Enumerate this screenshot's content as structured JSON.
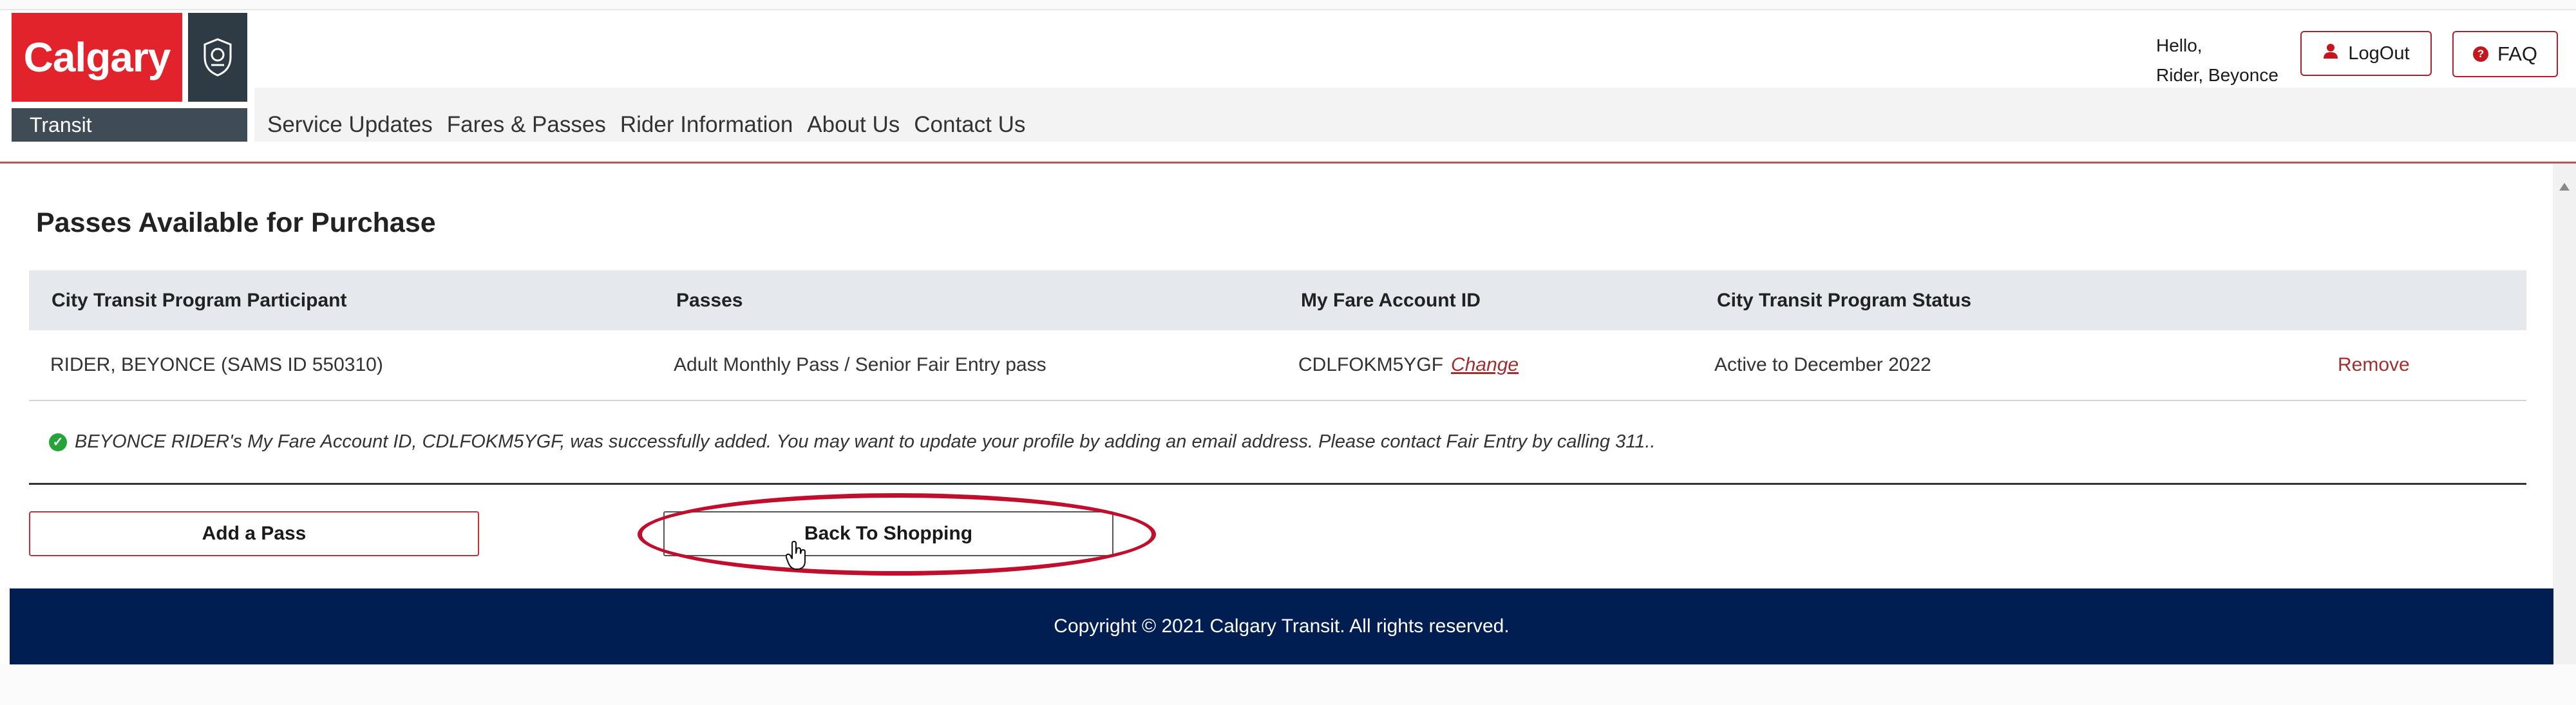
{
  "header": {
    "logo_brand": "Calgary",
    "logo_sub": "Transit",
    "nav": [
      "Service Updates",
      "Fares & Passes",
      "Rider Information",
      "About Us",
      "Contact Us"
    ],
    "greeting_line1": "Hello,",
    "greeting_line2": "Rider, Beyonce",
    "logout_label": "LogOut",
    "faq_label": "FAQ"
  },
  "main": {
    "title": "Passes Available for Purchase",
    "table": {
      "columns": [
        "City Transit Program Participant",
        "Passes",
        "My Fare Account ID",
        "City Transit Program Status"
      ],
      "rows": [
        {
          "participant": "RIDER, BEYONCE (SAMS ID 550310)",
          "passes": "Adult Monthly Pass / Senior Fair Entry pass",
          "account_id": "CDLFOKM5YGF",
          "change_label": "Change",
          "status": "Active to December 2022",
          "remove_label": "Remove"
        }
      ]
    },
    "message": "BEYONCE RIDER's My Fare Account ID, CDLFOKM5YGF, was successfully added. You may want to update your profile by adding an email address. Please contact Fair Entry by calling 311..",
    "add_pass_label": "Add a Pass",
    "back_label": "Back To Shopping"
  },
  "footer": {
    "copyright": "Copyright © 2021 Calgary Transit. All rights reserved."
  },
  "colors": {
    "brand_red": "#e3232b",
    "footer_navy": "#011e52",
    "annotation_red": "#c00e2c",
    "success_green": "#26a33a"
  },
  "icons": [
    "crest-icon",
    "user-icon",
    "question-icon",
    "check-circle-icon",
    "hand-cursor-icon"
  ]
}
